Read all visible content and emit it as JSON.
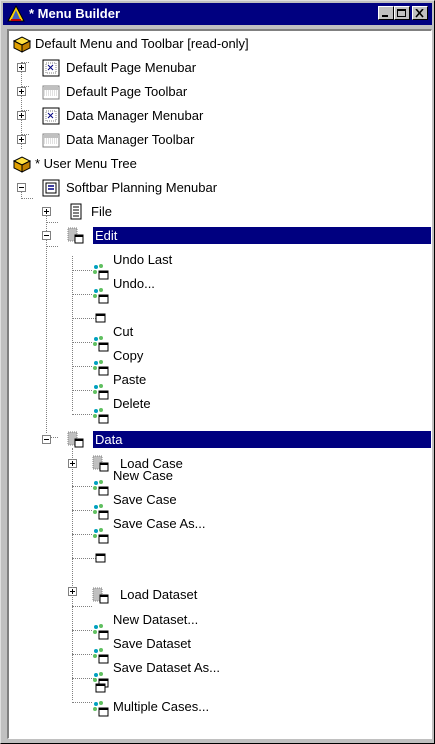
{
  "window": {
    "title": "* Menu Builder",
    "buttons": {
      "minimize": "minimize",
      "maximize": "maximize",
      "close": "close"
    }
  },
  "tree": {
    "default_root": "Default Menu and Toolbar [read-only]",
    "default_children": [
      "Default Page Menubar",
      "Default Page Toolbar",
      "Data Manager Menubar",
      "Data Manager Toolbar"
    ],
    "user_root": "* User Menu Tree",
    "softbar": "Softbar Planning Menubar",
    "file": "File",
    "edit": "Edit",
    "edit_items": [
      "Undo Last",
      "Undo...",
      "",
      "Cut",
      "Copy",
      "Paste",
      "Delete"
    ],
    "data": "Data",
    "data_items": [
      "Load Case",
      "New Case",
      "Save Case",
      "Save Case As...",
      "",
      "Load Dataset",
      "New Dataset...",
      "Save Dataset",
      "Save Dataset As...",
      "",
      "Multiple Cases..."
    ]
  },
  "colors": {
    "selection": "#000080",
    "title_bar": "#000080",
    "face": "#c0c0c0"
  }
}
